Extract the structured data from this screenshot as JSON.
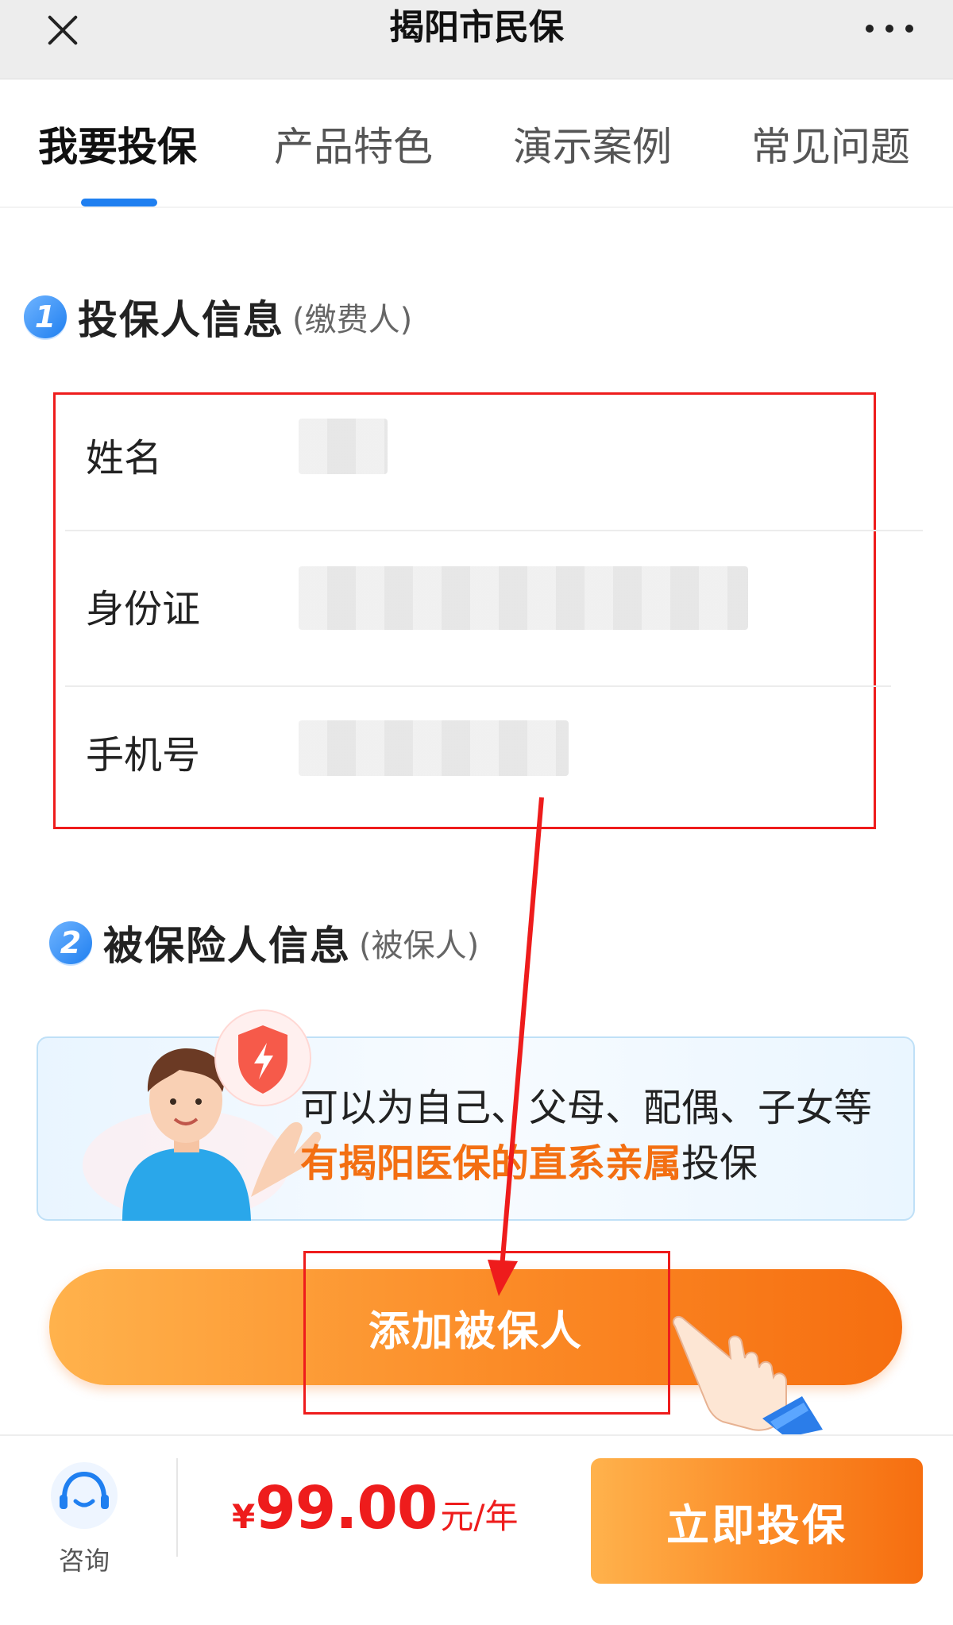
{
  "topbar": {
    "title": "揭阳市民保"
  },
  "tabs": [
    {
      "label": "我要投保",
      "active": true
    },
    {
      "label": "产品特色",
      "active": false
    },
    {
      "label": "演示案例",
      "active": false
    },
    {
      "label": "常见问题",
      "active": false
    }
  ],
  "section1": {
    "number": "1",
    "title": "投保人信息",
    "subtitle": "(缴费人)",
    "fields": [
      {
        "label": "姓名"
      },
      {
        "label": "身份证"
      },
      {
        "label": "手机号"
      }
    ]
  },
  "section2": {
    "number": "2",
    "title": "被保险人信息",
    "subtitle": "(被保人)"
  },
  "banner": {
    "line1": "可以为自己、父母、配偶、子女等",
    "highlight": "有揭阳医保的直系亲属",
    "line2_suffix": "投保"
  },
  "add_insured": {
    "label": "添加被保人"
  },
  "bottombar": {
    "consult_label": "咨询",
    "price_currency": "¥",
    "price_amount": "99.00",
    "price_unit": "元/年",
    "buy_label": "立即投保"
  },
  "colors": {
    "accent_blue": "#1f7ff0",
    "orange": "#f66e10",
    "price_red": "#ee1c1c",
    "annotation_red": "#ee1c1c"
  },
  "icons": [
    "close-icon",
    "more-icon",
    "shield-icon",
    "headset-icon",
    "hand-pointer-icon"
  ]
}
